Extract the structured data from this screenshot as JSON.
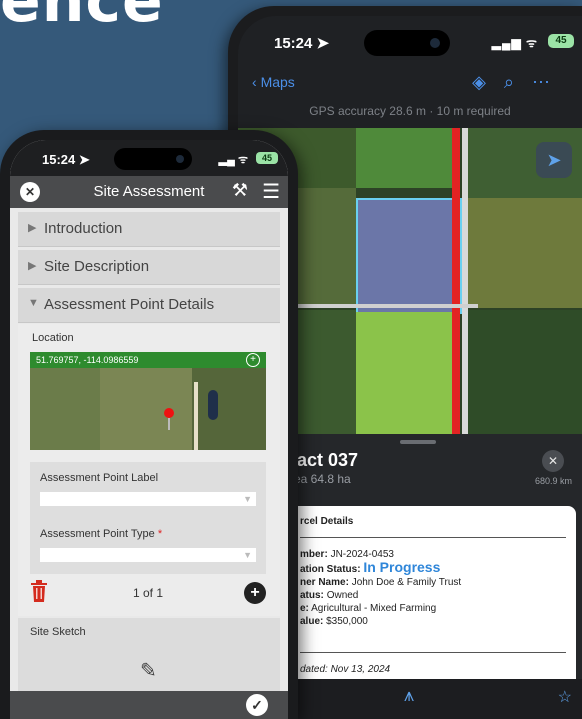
{
  "hero": {
    "text": "ence"
  },
  "maps_app": {
    "status": {
      "time": "15:24 ➤",
      "signal": "▂▄▆ ᯤ",
      "battery": "45"
    },
    "nav": {
      "back_label": "Maps"
    },
    "gps_text": "GPS accuracy 28.6 m · 10 m required",
    "sheet": {
      "tract_title": "ract 037",
      "area": "rea 64.8 ha",
      "distance": "680.9 km"
    },
    "card": {
      "title": "rcel Details",
      "number": {
        "label": "mber:",
        "value": "JN-2024-0453"
      },
      "status": {
        "label": "ation Status:",
        "value": "In Progress"
      },
      "owner": {
        "label": "ner Name:",
        "value": "John Doe & Family Trust"
      },
      "ownership": {
        "label": "atus:",
        "value": "Owned"
      },
      "use": {
        "label": "e:",
        "value": "Agricultural - Mixed Farming"
      },
      "value": {
        "label": "alue:",
        "value": "$350,000"
      },
      "updated": "dated: Nov 13, 2024"
    }
  },
  "survey_app": {
    "status": {
      "time": "15:24 ➤",
      "signal": "▂▄ ᯤ",
      "battery": "45"
    },
    "title": "Site Assessment",
    "sections": [
      {
        "arrow": "▶",
        "label": "Introduction"
      },
      {
        "arrow": "▶",
        "label": "Site Description"
      },
      {
        "arrow": "▼",
        "label": "Assessment Point Details"
      }
    ],
    "location": {
      "label": "Location",
      "coords": "51.769757, -114.0986559"
    },
    "fields": [
      {
        "label": "Assessment Point Label",
        "required": ""
      },
      {
        "label": "Assessment Point Type",
        "required": "*"
      }
    ],
    "pager": {
      "text": "1 of 1"
    },
    "sketch": {
      "label": "Site Sketch"
    }
  },
  "colors": {
    "background": "#35597a",
    "accent_blue": "#2f86d9",
    "nav_blue": "#4b8fe8",
    "geo_green": "#2e8b2e",
    "tract_red": "#e22323"
  }
}
